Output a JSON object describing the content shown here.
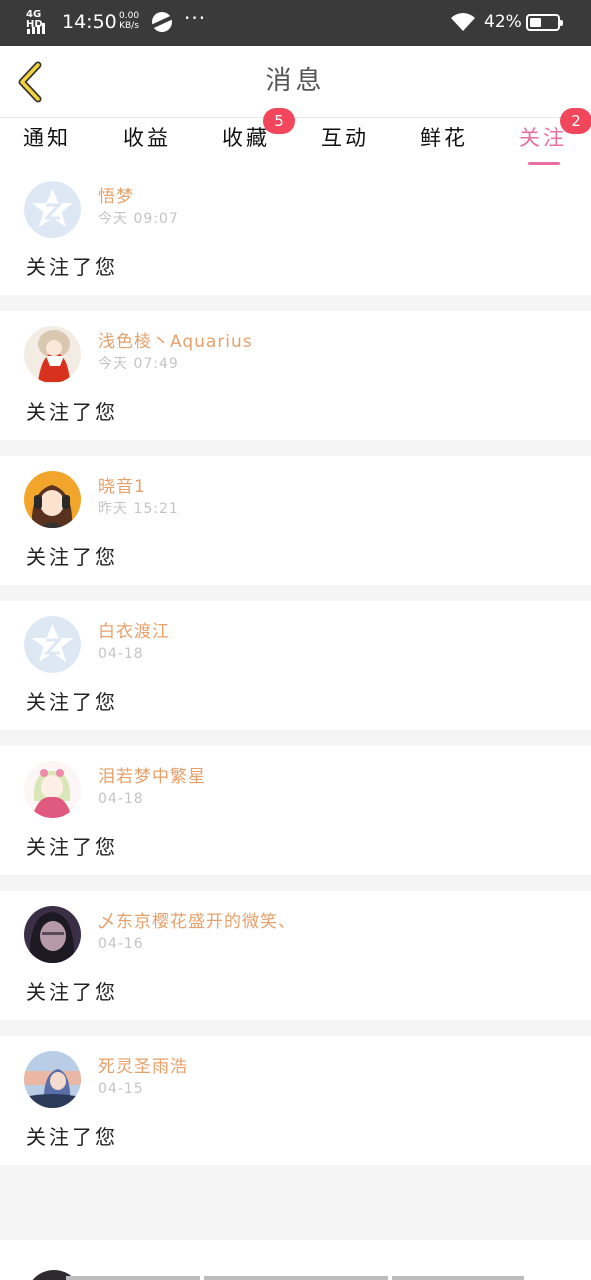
{
  "status_bar": {
    "network": "4G HD",
    "time": "14:50",
    "speed": "0.00",
    "speed_unit": "KB/s",
    "more": "···",
    "battery": "42%",
    "battery_level": 0.42
  },
  "header": {
    "title": "消息",
    "back_icon": "chevron-left-icon"
  },
  "tabs": [
    {
      "label": "通知"
    },
    {
      "label": "收益"
    },
    {
      "label": "收藏",
      "badge": "5"
    },
    {
      "label": "互动"
    },
    {
      "label": "鲜花"
    },
    {
      "label": "关注",
      "badge": "2",
      "active": true
    }
  ],
  "accent_color": "#e76fa2",
  "badge_color": "#f2465c",
  "name_color": "#e8a06a",
  "items": [
    {
      "name": "悟梦",
      "time": "今天 09:07",
      "message": "关注了您",
      "avatar": "default-star-avatar"
    },
    {
      "name": "浅色棱丶Aquarius",
      "time": "今天 07:49",
      "message": "关注了您",
      "avatar": "anime-girl-red-avatar"
    },
    {
      "name": "晓音1",
      "time": "昨天 15:21",
      "message": "关注了您",
      "avatar": "anime-girl-headphones-avatar"
    },
    {
      "name": "白衣渡江",
      "time": "04-18",
      "message": "关注了您",
      "avatar": "default-star-avatar"
    },
    {
      "name": "泪若梦中繁星",
      "time": "04-18",
      "message": "关注了您",
      "avatar": "anime-girl-pink-avatar"
    },
    {
      "name": "乄东京樱花盛开的微笑、",
      "time": "04-16",
      "message": "关注了您",
      "avatar": "photo-girl-avatar"
    },
    {
      "name": "死灵圣雨浩",
      "time": "04-15",
      "message": "关注了您",
      "avatar": "anime-boy-sky-avatar"
    }
  ]
}
